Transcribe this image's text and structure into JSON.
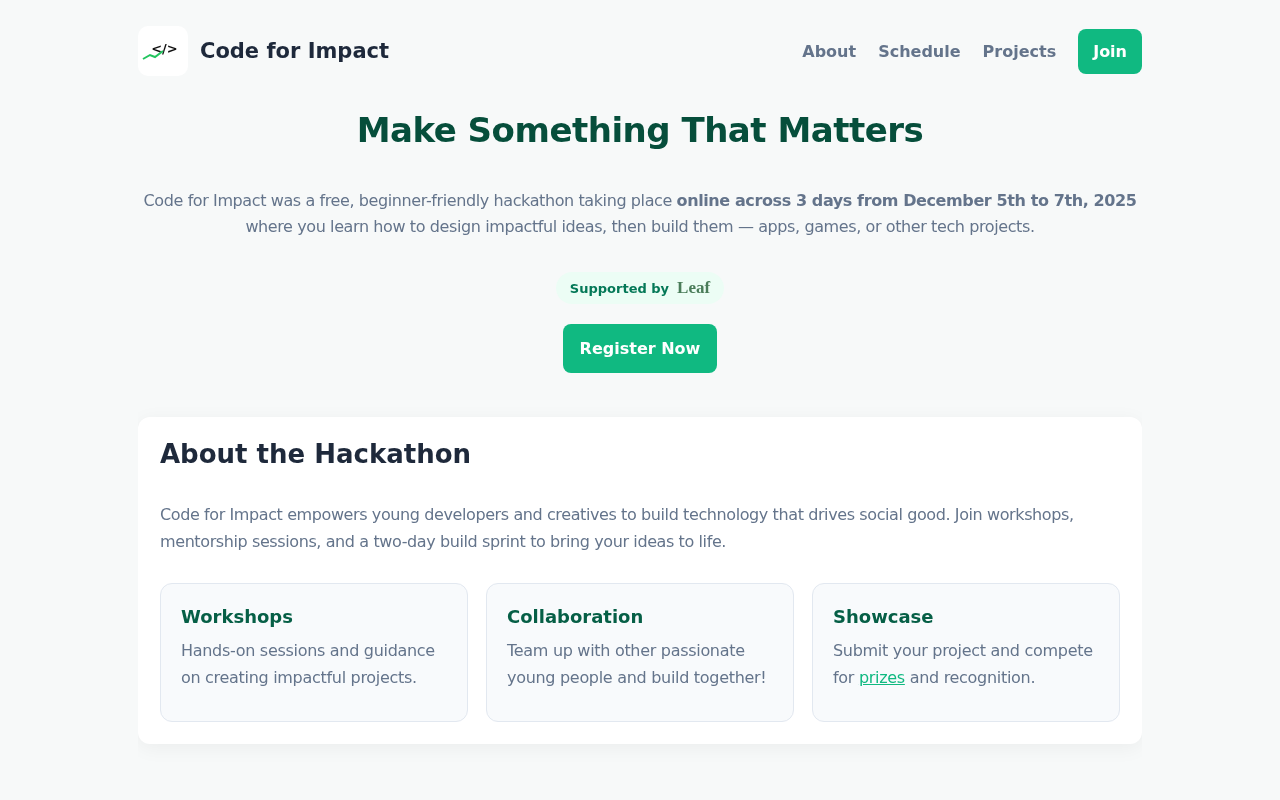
{
  "header": {
    "logo_glyph": "</>",
    "brand": "Code for Impact",
    "nav": [
      {
        "label": "About",
        "kind": "link"
      },
      {
        "label": "Schedule",
        "kind": "link"
      },
      {
        "label": "Projects",
        "kind": "link"
      },
      {
        "label": "Join",
        "kind": "button"
      }
    ]
  },
  "hero": {
    "title": "Make Something That Matters",
    "description": "Code for Impact was a free, beginner-friendly hackathon taking place **online across 3 days from December 5th to 7th, 2025** where you learn how to design impactful ideas, then build them — apps, games, or other tech projects.",
    "supported_by": "Supported by",
    "sponsor": "Leaf",
    "cta": "Register Now"
  },
  "about": {
    "title": "About the Hackathon",
    "text": "Code for Impact empowers young developers and creatives to build technology that drives social good. Join workshops, mentorship sessions, and a two-day build sprint to bring your ideas to life.",
    "features": [
      {
        "title": "Workshops",
        "text_before": "Hands-on sessions and guidance on creating impactful projects."
      },
      {
        "title": "Collaboration",
        "text_before": "Team up with other passionate young people and build together!"
      },
      {
        "title": "Showcase",
        "text_before": "Submit your project and compete for",
        "link": "prizes",
        "text_after": "and recognition."
      }
    ]
  }
}
